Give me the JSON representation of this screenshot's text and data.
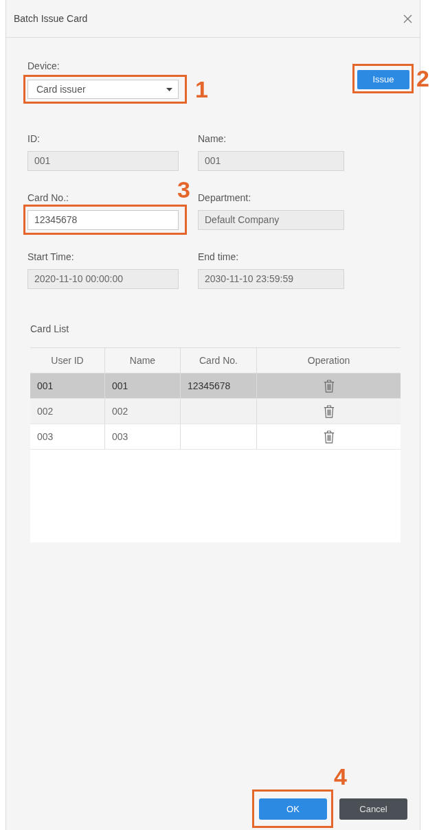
{
  "dialog": {
    "title": "Batch Issue Card"
  },
  "device": {
    "label": "Device:",
    "value": "Card issuer",
    "callout": "1"
  },
  "issue_button": {
    "label": "Issue",
    "callout": "2"
  },
  "fields": [
    {
      "label": "ID:",
      "value": "001",
      "disabled": true
    },
    {
      "label": "Name:",
      "value": "001",
      "disabled": true
    },
    {
      "label": "Card No.:",
      "value": "12345678",
      "disabled": false,
      "callout": "3"
    },
    {
      "label": "Department:",
      "value": "Default Company",
      "disabled": true
    },
    {
      "label": "Start Time:",
      "value": "2020-11-10 00:00:00",
      "disabled": true
    },
    {
      "label": "End time:",
      "value": "2030-11-10 23:59:59",
      "disabled": true
    }
  ],
  "card_list": {
    "title": "Card List",
    "columns": [
      "User ID",
      "Name",
      "Card No.",
      "Operation"
    ],
    "rows": [
      {
        "user_id": "001",
        "name": "001",
        "card_no": "12345678",
        "selected": true
      },
      {
        "user_id": "002",
        "name": "002",
        "selected": false
      },
      {
        "user_id": "003",
        "name": "003",
        "selected": false
      }
    ]
  },
  "footer_buttons": [
    {
      "label": "OK",
      "kind": "primary",
      "callout": "4"
    },
    {
      "label": "Cancel",
      "kind": "secondary"
    }
  ]
}
